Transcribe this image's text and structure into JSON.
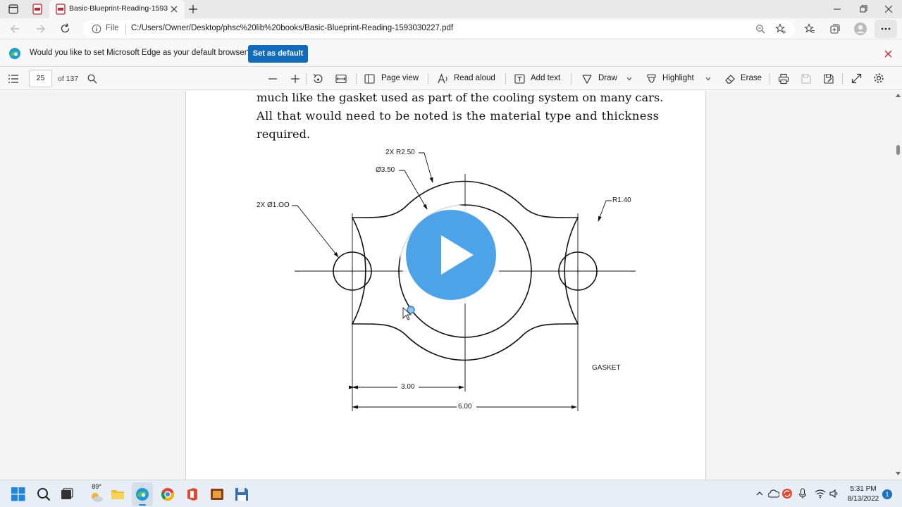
{
  "browser": {
    "tab_title": "Basic-Blueprint-Reading-1593030227.pdf",
    "file_label": "File",
    "url": "C:/Users/Owner/Desktop/phsc%20lib%20books/Basic-Blueprint-Reading-1593030227.pdf"
  },
  "infobar": {
    "message": "Would you like to set Microsoft Edge as your default browser?",
    "button": "Set as default"
  },
  "pdf_toolbar": {
    "page_number": "25",
    "page_count": "of 137",
    "page_view": "Page view",
    "read_aloud": "Read aloud",
    "add_text": "Add text",
    "draw": "Draw",
    "highlight": "Highlight",
    "erase": "Erase"
  },
  "document": {
    "lines": [
      "much like the gasket used as part of the cooling system on many cars.",
      "All that would need to be noted is the material type and thickness",
      "required."
    ],
    "drawing": {
      "label_2x_r250": "2X R2.50",
      "label_dia350": "Ø3.50",
      "label_2x_dia100": "2X Ø1.OO",
      "label_r140": "R1.40",
      "label_gasket": "GASKET",
      "dim_300": "3.00",
      "dim_600": "6.00"
    }
  },
  "taskbar": {
    "weather": "89°",
    "time": "5:31 PM",
    "date": "8/13/2022",
    "notifications": "1"
  },
  "colors": {
    "accent": "#0f6cbd",
    "play_button": "#4da3e8"
  }
}
